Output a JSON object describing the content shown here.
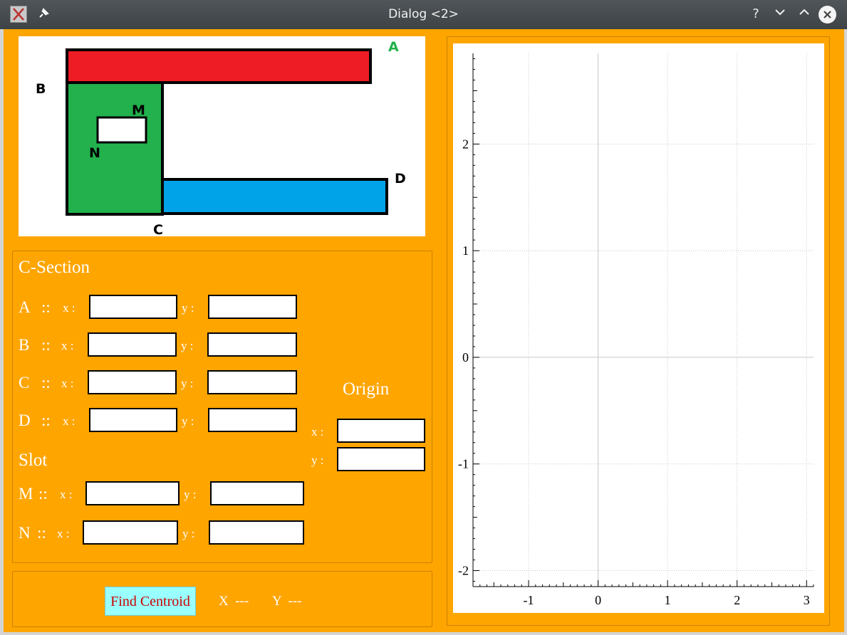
{
  "window": {
    "title": "Dialog <2>",
    "help_glyph": "?",
    "min_glyph": "⌄",
    "max_glyph": "⌃"
  },
  "diagram": {
    "label_a": "A",
    "label_b": "B",
    "label_c": "C",
    "label_d": "D",
    "label_m": "M",
    "label_n": "N"
  },
  "csection": {
    "title": "C-Section",
    "rows": [
      {
        "name": "A",
        "sep": "::",
        "x_label": "x :",
        "y_label": "y :",
        "x_value": "",
        "y_value": ""
      },
      {
        "name": "B",
        "sep": "::",
        "x_label": "x :",
        "y_label": "y :",
        "x_value": "",
        "y_value": ""
      },
      {
        "name": "C",
        "sep": "::",
        "x_label": "x :",
        "y_label": "y :",
        "x_value": "",
        "y_value": ""
      },
      {
        "name": "D",
        "sep": "::",
        "x_label": "x :",
        "y_label": "y :",
        "x_value": "",
        "y_value": ""
      }
    ]
  },
  "slot": {
    "title": "Slot",
    "rows": [
      {
        "name": "M",
        "sep": "::",
        "x_label": "x :",
        "y_label": "y :",
        "x_value": "",
        "y_value": ""
      },
      {
        "name": "N",
        "sep": "::",
        "x_label": "x :",
        "y_label": "y :",
        "x_value": "",
        "y_value": ""
      }
    ]
  },
  "origin": {
    "title": "Origin",
    "x_label": "x :",
    "y_label": "y :",
    "x_value": "",
    "y_value": ""
  },
  "result": {
    "button_label": "Find Centroid",
    "x_text": "X  ---",
    "y_text": "Y  ---"
  },
  "chart_data": {
    "type": "scatter",
    "series": [],
    "xlim": [
      -1.8,
      3.1
    ],
    "ylim": [
      -2.15,
      2.85
    ],
    "x_ticks": [
      -1,
      0,
      1,
      2,
      3
    ],
    "y_ticks": [
      -2,
      -1,
      0,
      1,
      2
    ],
    "grid": true,
    "title": "",
    "xlabel": "",
    "ylabel": ""
  }
}
